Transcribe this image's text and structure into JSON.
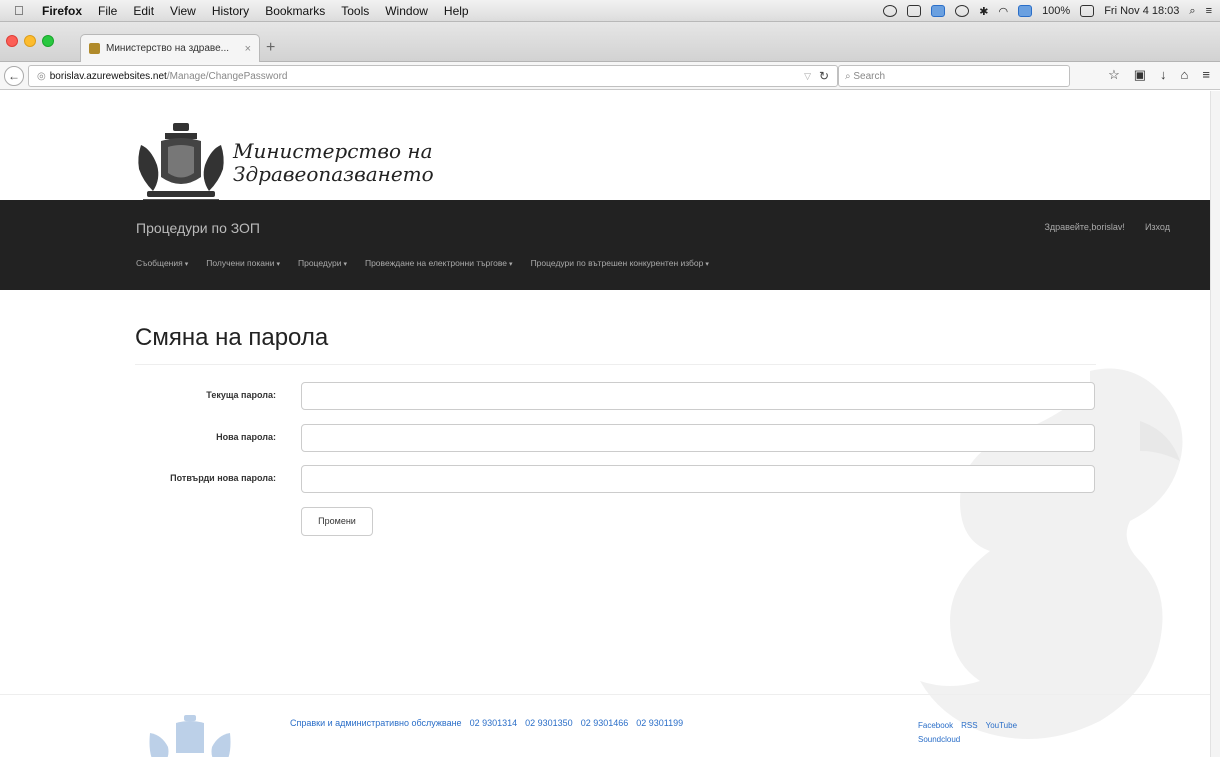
{
  "menubar": {
    "app": "Firefox",
    "items": [
      "File",
      "Edit",
      "View",
      "History",
      "Bookmarks",
      "Tools",
      "Window",
      "Help"
    ],
    "battery": "100%",
    "clock": "Fri Nov 4  18:03"
  },
  "browser": {
    "tab_title": "Министерство на здраве...",
    "tab_close": "×",
    "new_tab": "+",
    "url_host": "borislav.azurewebsites.net",
    "url_path": "/Manage/ChangePassword",
    "search_placeholder": "Search"
  },
  "site": {
    "brand_line1": "Министерство на",
    "brand_line2": "Здравеопазването",
    "nav_brand": "Процедури по ЗОП",
    "greeting": "Здравейте,borislav!",
    "logout": "Изход",
    "menu": [
      "Съобщения",
      "Получени покани",
      "Процедури",
      "Провеждане на електронни търгове",
      "Процедури по вътрешен конкурентен избор"
    ]
  },
  "form": {
    "title": "Смяна на парола",
    "current_label": "Текуща парола:",
    "new_label": "Нова парола:",
    "confirm_label": "Потвърди нова парола:",
    "submit": "Промени"
  },
  "footer": {
    "contact_label": "Справки и административно обслужване",
    "phones": [
      "02 9301314",
      "02 9301350",
      "02 9301466",
      "02 9301199"
    ],
    "social": [
      "Facebook",
      "RSS",
      "YouTube",
      "Soundcloud"
    ]
  }
}
